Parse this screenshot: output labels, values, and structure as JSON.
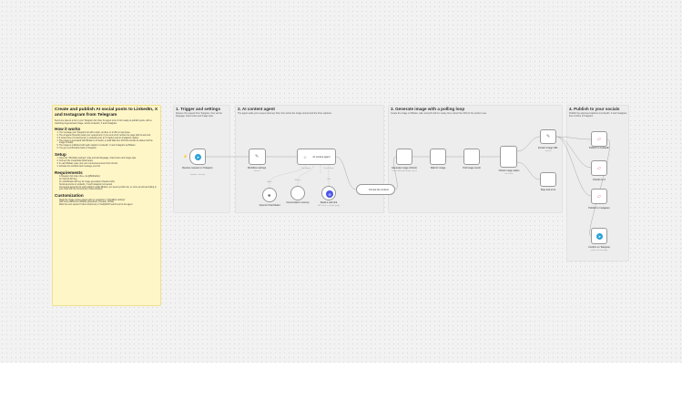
{
  "notes": {
    "title": "Create and publish AI social posts to LinkedIn, X and Instagram from Telegram",
    "intro": "Send one idea to a bot in your Telegram bot chat. An agent turns it into ready-to-publish posts, with a matching AI-generated image, across LinkedIn, X and Instagram.",
    "how_title": "How it works",
    "how_steps": [
      "You message your Telegram bot with a topic, an idea, or a URL to repurpose.",
      "The AI agent (OpenAI) reads your request and, if you sent a link, fetches the page with its web tool.",
      "It writes three on-brand posts, a LinkedIn post, an X caption and an Instagram caption.",
      "The image is generated with Blotato in AI studio; a small Wait then Poll flow checks its status until the image is ready.",
      "The image is published with each caption to LinkedIn, X and Instagram via Blotato.",
      "You get a confirmation back in Telegram."
    ],
    "setup_title": "Setup",
    "setup_steps": [
      "Open the \"Workflow settings\" node and add language, brand voice and image style.",
      "Connect the credentials listed below.",
      "In each Blotato node, pick your connected account from the list.",
      "Activate the workflow and message your bot."
    ],
    "req_title": "Requirements",
    "req_items": [
      "A Telegram bot token (free, via @BotFather)",
      "An OpenAI API key",
      "An ultra Blotato API key for image generation (Header Auth)",
      "Social accounts on LinkedIn, X and Instagram connected",
      "Connected accounts for each platform inside Blotato; you need a public site, or more as well according to your Chat with the Community / Notes blocked."
    ],
    "custom_title": "Customization",
    "custom_items": [
      "Swap the image model, aspect ratio or resolution in \"Workflow settings\".",
      "Add more platforms to Blotato (Facebook, Threads, TikTok).",
      "Want the next session? Add a Perplexity or Tavily/MCP search tool to the agent."
    ]
  },
  "sections": {
    "s1": {
      "title": "1. Trigger and settings",
      "desc": "Receive the request from Telegram, then set the language, brand voice and image style."
    },
    "s2": {
      "title": "2. AI content agent",
      "desc": "The agent reads your request (and any link), then writes the image prompt and the three captions."
    },
    "s3": {
      "title": "3. Generate image with a polling loop",
      "desc": "Create the image on Blotato, wait, and poll until it is ready, then extract the URL for the posts to use."
    },
    "s4": {
      "title": "4. Publish to your socials",
      "desc": "Publish the approved captions to LinkedIn, X and Instagram, then confirm in Telegram."
    }
  },
  "nodes": {
    "telegram_trigger": {
      "label": "Receive request on Telegram",
      "sub": "Updates: message",
      "icon": "telegram-icon"
    },
    "workflow_settings": {
      "label": "Workflow settings",
      "sub": "manual",
      "icon": "pencil-icon"
    },
    "ai_agent": {
      "label": "AI content agent",
      "sub": "Tools Agent",
      "icon": "robot-icon"
    },
    "openai_model": {
      "label": "OpenAI Chat Model",
      "icon": "openai-icon"
    },
    "memory": {
      "label": "Conversation memory",
      "icon": "memory-icon"
    },
    "web_tool": {
      "label": "Read a web link",
      "sub": "GET: fetch a url (web page)",
      "icon": "globe-icon"
    },
    "format_content": {
      "label": "Format the content",
      "icon": "code-icon"
    },
    "generate_image": {
      "label": "Generate image (Ghost)",
      "sub": "Create Blotato AI image source",
      "icon": "image-icon"
    },
    "wait_image": {
      "label": "Wait for image",
      "icon": "clock-icon"
    },
    "poll_result": {
      "label": "Poll image result",
      "icon": "refresh-icon"
    },
    "check_ready": {
      "label": "Check image status",
      "sub": "true / false",
      "icon": "switch-icon"
    },
    "extract_url": {
      "label": "Extract image URL",
      "sub": "manual",
      "icon": "pencil-icon"
    },
    "stop_error": {
      "label": "Stop and error",
      "icon": "stop-icon"
    },
    "publish_linkedin": {
      "label": "Publish to LinkedIn",
      "icon": "blotato-icon"
    },
    "publish_x": {
      "label": "Publish to X",
      "icon": "blotato-icon"
    },
    "publish_instagram": {
      "label": "Publish to Instagram",
      "icon": "blotato-icon"
    },
    "confirm_telegram": {
      "label": "Confirm on Telegram",
      "sub": "send a text message",
      "icon": "telegram-icon"
    }
  },
  "wire_labels": {
    "model": "Model",
    "memory": "Memory",
    "tool": "Tool",
    "output": "Output Parser"
  },
  "colors": {
    "accent": "#ff6d5a",
    "telegram": "#2aa1da",
    "blotato": "#e04992",
    "sticky_yellow": "#fff6c7",
    "sticky_gray": "#ededed"
  }
}
